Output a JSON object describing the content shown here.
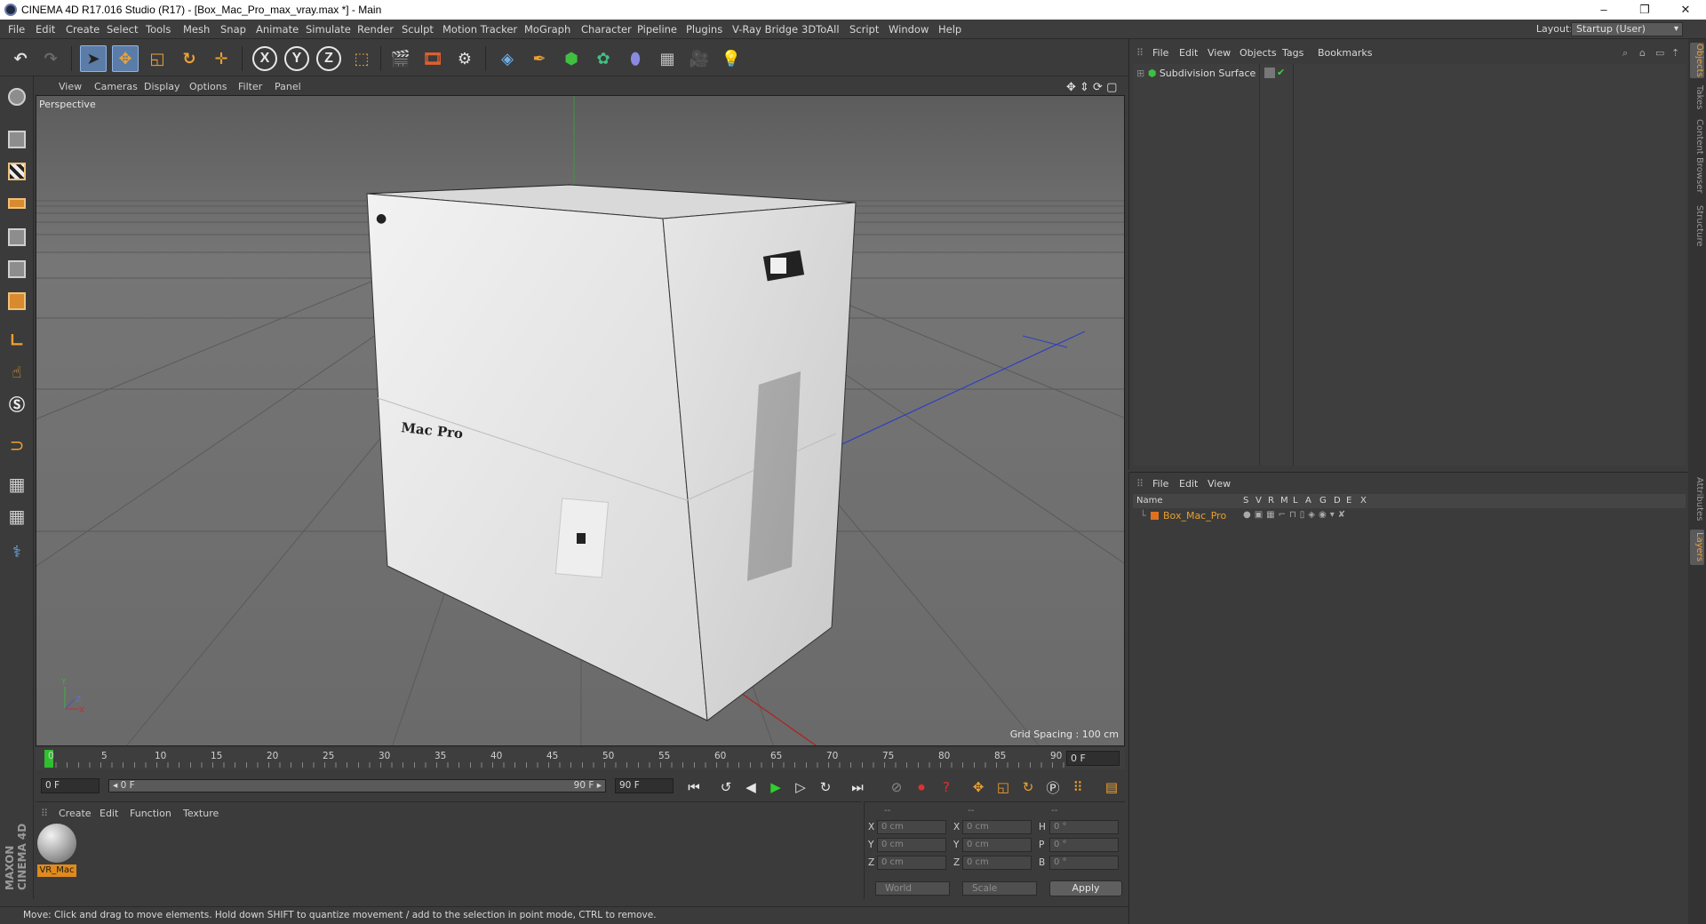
{
  "window": {
    "title": "CINEMA 4D R17.016 Studio (R17) - [Box_Mac_Pro_max_vray.max *] - Main",
    "minimize": "–",
    "maximize": "❐",
    "close": "✕"
  },
  "menubar": {
    "items": [
      "File",
      "Edit",
      "Create",
      "Select",
      "Tools",
      "Mesh",
      "Snap",
      "Animate",
      "Simulate",
      "Render",
      "Sculpt",
      "Motion Tracker",
      "MoGraph",
      "Character",
      "Pipeline",
      "Plugins",
      "V-Ray Bridge",
      "3DToAll",
      "Script",
      "Window",
      "Help"
    ],
    "layout_label": "Layout:",
    "layout_value": "Startup (User)"
  },
  "viewport": {
    "menu": [
      "View",
      "Cameras",
      "Display",
      "Options",
      "Filter",
      "Panel"
    ],
    "camera_label": "Perspective",
    "grid_spacing": "Grid Spacing : 100 cm",
    "box_text": "Mac Pro"
  },
  "timeline": {
    "ticks": [
      "0",
      "5",
      "10",
      "15",
      "20",
      "25",
      "30",
      "35",
      "40",
      "45",
      "50",
      "55",
      "60",
      "65",
      "70",
      "75",
      "80",
      "85",
      "90"
    ],
    "current_frame": "0 F",
    "start_field": "0 F",
    "range_start": "◂ 0 F",
    "range_end": "90 F ▸",
    "end_field": "90 F"
  },
  "material_manager": {
    "menu": [
      "Create",
      "Edit",
      "Function",
      "Texture"
    ],
    "material_name": "VR_Mac"
  },
  "coordinates": {
    "header": [
      "--",
      "--",
      "--"
    ],
    "rows": [
      {
        "l1": "X",
        "v1": "0 cm",
        "l2": "X",
        "v2": "0 cm",
        "l3": "H",
        "v3": "0 °"
      },
      {
        "l1": "Y",
        "v1": "0 cm",
        "l2": "Y",
        "v2": "0 cm",
        "l3": "P",
        "v3": "0 °"
      },
      {
        "l1": "Z",
        "v1": "0 cm",
        "l2": "Z",
        "v2": "0 cm",
        "l3": "B",
        "v3": "0 °"
      }
    ],
    "space": "World",
    "mode": "Scale",
    "apply": "Apply"
  },
  "status": "Move: Click and drag to move elements. Hold down SHIFT to quantize movement / add to the selection in point mode, CTRL to remove.",
  "object_manager": {
    "menu": [
      "File",
      "Edit",
      "View",
      "Objects",
      "Tags",
      "Bookmarks"
    ],
    "object_name": "Subdivision Surface"
  },
  "layer_manager": {
    "menu": [
      "File",
      "Edit",
      "View"
    ],
    "columns": [
      "Name",
      "S",
      "V",
      "R",
      "M",
      "L",
      "A",
      "G",
      "D",
      "E",
      "X"
    ],
    "layer_name": "Box_Mac_Pro",
    "layer_color": "#e07020"
  },
  "side_tabs": [
    "Objects",
    "Takes",
    "Content Browser",
    "Structure",
    "Attributes",
    "Layers"
  ],
  "logo": "MAXON CINEMA 4D"
}
